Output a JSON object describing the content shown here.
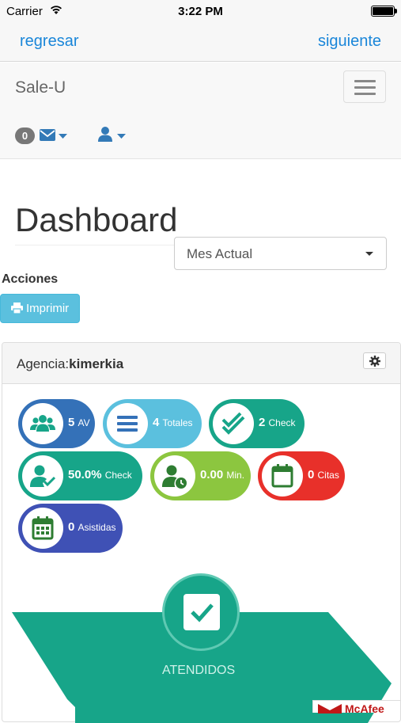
{
  "status_bar": {
    "carrier": "Carrier",
    "time": "3:22 PM"
  },
  "web_nav": {
    "back_label": "regresar",
    "next_label": "siguiente"
  },
  "navbar": {
    "brand": "Sale-U",
    "message_count": "0"
  },
  "main": {
    "title": "Dashboard",
    "period_select": "Mes Actual",
    "actions_label": "Acciones",
    "print_label": "Imprimir"
  },
  "panel": {
    "agency_label": "Agencia:",
    "agency_name": "kimerkia"
  },
  "stats": [
    {
      "value": "5",
      "unit": "AV",
      "color": "#3471b8",
      "icon": "group-icon"
    },
    {
      "value": "4",
      "unit": "Totales",
      "color": "#5bc0de",
      "icon": "list-icon"
    },
    {
      "value": "2",
      "unit": "Check",
      "color": "#17a589",
      "icon": "double-check-icon"
    },
    {
      "value": "50.0%",
      "unit": "Check",
      "color": "#17a589",
      "icon": "user-check-icon"
    },
    {
      "value": "0.00",
      "unit": "Min.",
      "color": "#8cc63f",
      "icon": "user-clock-icon"
    },
    {
      "value": "0",
      "unit": "Citas",
      "color": "#e8302a",
      "icon": "calendar-icon"
    },
    {
      "value": "0",
      "unit": "Asistidas",
      "color": "#3f51b5",
      "icon": "calendar-grid-icon"
    }
  ],
  "attended": {
    "label": "ATENDIDOS",
    "color": "#17a589"
  },
  "badge": {
    "text": "McAfee"
  }
}
